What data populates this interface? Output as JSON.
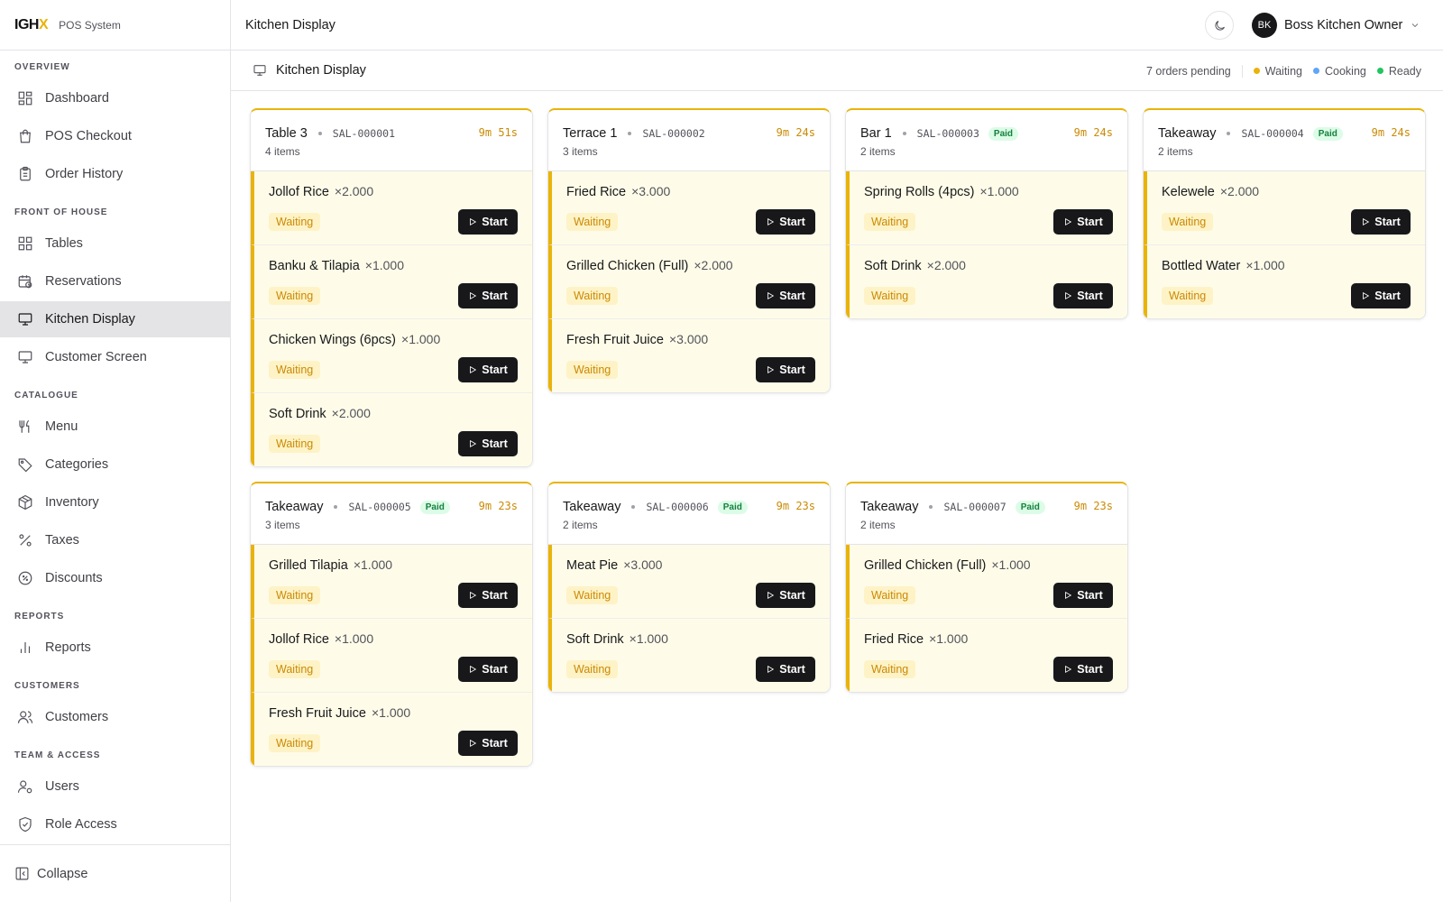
{
  "brand": {
    "logo_main": "IGH",
    "logo_x": "X",
    "name": "POS System"
  },
  "sidebar": {
    "sections": {
      "overview": "OVERVIEW",
      "front": "FRONT OF HOUSE",
      "catalogue": "CATALOGUE",
      "reports": "REPORTS",
      "customers": "CUSTOMERS",
      "team": "TEAM & ACCESS"
    },
    "items": {
      "dashboard": "Dashboard",
      "pos": "POS Checkout",
      "orders": "Order History",
      "tables": "Tables",
      "reservations": "Reservations",
      "kitchen": "Kitchen Display",
      "customer_screen": "Customer Screen",
      "menu": "Menu",
      "categories": "Categories",
      "inventory": "Inventory",
      "taxes": "Taxes",
      "discounts": "Discounts",
      "reports": "Reports",
      "customers": "Customers",
      "users": "Users",
      "roles": "Role Access"
    },
    "collapse": "Collapse"
  },
  "topbar": {
    "title": "Kitchen Display",
    "avatar": "BK",
    "user_name": "Boss Kitchen Owner"
  },
  "subheader": {
    "title": "Kitchen Display",
    "pending": "7 orders pending",
    "legend": {
      "waiting": "Waiting",
      "cooking": "Cooking",
      "ready": "Ready"
    }
  },
  "colors": {
    "accent": "#eab308",
    "waiting": "#eab308",
    "cooking": "#60a5fa",
    "ready": "#22c55e",
    "paid_bg": "#dcfce7",
    "paid_text": "#15803d"
  },
  "labels": {
    "start": "Start",
    "status": "Waiting",
    "paid": "Paid"
  },
  "orders": [
    {
      "location": "Table 3",
      "sale": "SAL-000001",
      "paid": false,
      "time": "9m 51s",
      "count": "4 items",
      "items": [
        {
          "name": "Jollof Rice",
          "qty": "×2.000"
        },
        {
          "name": "Banku & Tilapia",
          "qty": "×1.000"
        },
        {
          "name": "Chicken Wings (6pcs)",
          "qty": "×1.000"
        },
        {
          "name": "Soft Drink",
          "qty": "×2.000"
        }
      ]
    },
    {
      "location": "Terrace 1",
      "sale": "SAL-000002",
      "paid": false,
      "time": "9m 24s",
      "count": "3 items",
      "items": [
        {
          "name": "Fried Rice",
          "qty": "×3.000"
        },
        {
          "name": "Grilled Chicken (Full)",
          "qty": "×2.000"
        },
        {
          "name": "Fresh Fruit Juice",
          "qty": "×3.000"
        }
      ]
    },
    {
      "location": "Bar 1",
      "sale": "SAL-000003",
      "paid": true,
      "time": "9m 24s",
      "count": "2 items",
      "items": [
        {
          "name": "Spring Rolls (4pcs)",
          "qty": "×1.000"
        },
        {
          "name": "Soft Drink",
          "qty": "×2.000"
        }
      ]
    },
    {
      "location": "Takeaway",
      "sale": "SAL-000004",
      "paid": true,
      "time": "9m 24s",
      "count": "2 items",
      "items": [
        {
          "name": "Kelewele",
          "qty": "×2.000"
        },
        {
          "name": "Bottled Water",
          "qty": "×1.000"
        }
      ]
    },
    {
      "location": "Takeaway",
      "sale": "SAL-000005",
      "paid": true,
      "time": "9m 23s",
      "count": "3 items",
      "items": [
        {
          "name": "Grilled Tilapia",
          "qty": "×1.000"
        },
        {
          "name": "Jollof Rice",
          "qty": "×1.000"
        },
        {
          "name": "Fresh Fruit Juice",
          "qty": "×1.000"
        }
      ]
    },
    {
      "location": "Takeaway",
      "sale": "SAL-000006",
      "paid": true,
      "time": "9m 23s",
      "count": "2 items",
      "items": [
        {
          "name": "Meat Pie",
          "qty": "×3.000"
        },
        {
          "name": "Soft Drink",
          "qty": "×1.000"
        }
      ]
    },
    {
      "location": "Takeaway",
      "sale": "SAL-000007",
      "paid": true,
      "time": "9m 23s",
      "count": "2 items",
      "items": [
        {
          "name": "Grilled Chicken (Full)",
          "qty": "×1.000"
        },
        {
          "name": "Fried Rice",
          "qty": "×1.000"
        }
      ]
    }
  ]
}
